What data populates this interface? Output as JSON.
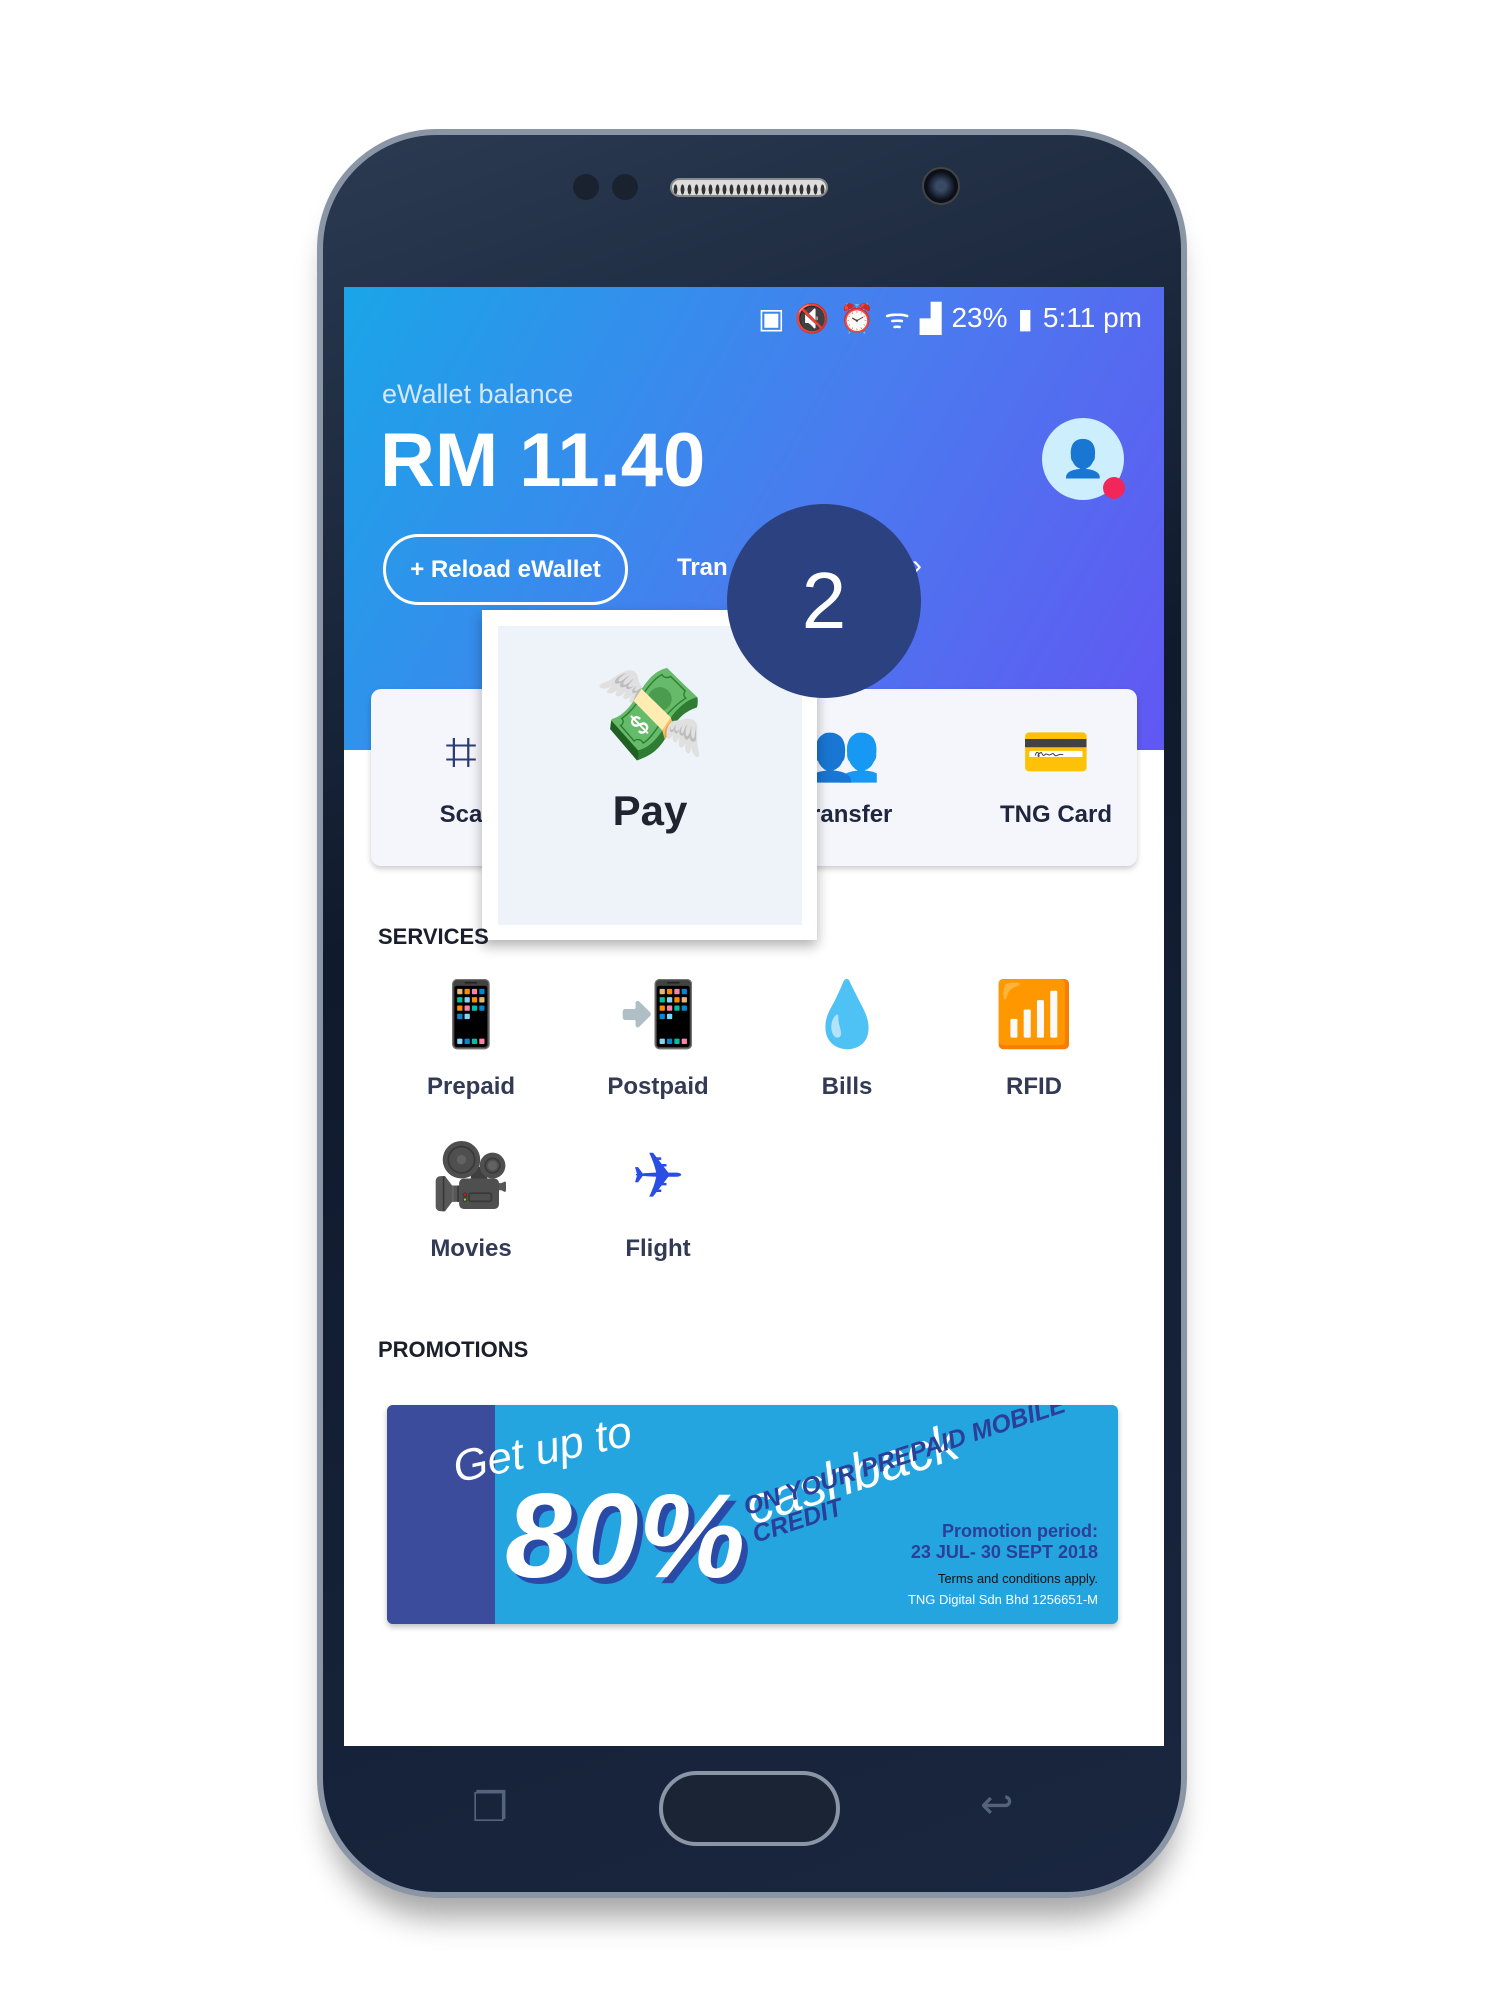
{
  "status_bar": {
    "battery_percent": "23%",
    "time": "5:11 pm",
    "icons": [
      "battery-saver-icon",
      "mute-vibrate-icon",
      "alarm-icon",
      "wifi-icon",
      "signal-icon",
      "battery-icon"
    ]
  },
  "wallet": {
    "label": "eWallet balance",
    "balance": "RM 11.40",
    "reload_label": "+ Reload eWallet",
    "transactions_label_partial": "Tran"
  },
  "quick_actions": [
    {
      "label": "Sca",
      "icon": "scan-icon"
    },
    {
      "label": "Pay",
      "icon": "pay-icon"
    },
    {
      "label": "ransfer",
      "icon": "transfer-icon"
    },
    {
      "label": "TNG Card",
      "icon": "tng-card-icon"
    }
  ],
  "tutorial": {
    "step": "2",
    "highlight_label": "Pay"
  },
  "services": {
    "heading": "SERVICES",
    "items": [
      {
        "label": "Prepaid"
      },
      {
        "label": "Postpaid"
      },
      {
        "label": "Bills"
      },
      {
        "label": "RFID"
      },
      {
        "label": "Movies"
      },
      {
        "label": "Flight"
      }
    ]
  },
  "promotions": {
    "heading": "PROMOTIONS",
    "banner": {
      "line1": "Get up to",
      "big": "80%",
      "line2": "cashback",
      "line3": "ON YOUR PREPAID MOBILE CREDIT",
      "period_label": "Promotion period:",
      "period": "23 JUL- 30 SEPT 2018",
      "terms": "Terms and conditions apply.",
      "company": "TNG Digital Sdn Bhd 1256651-M"
    }
  },
  "colors": {
    "accent": "#2a4de4",
    "header_start": "#1aa5e8",
    "header_end": "#6157f2",
    "step_badge": "#2c4280",
    "notification": "#f2265a"
  }
}
